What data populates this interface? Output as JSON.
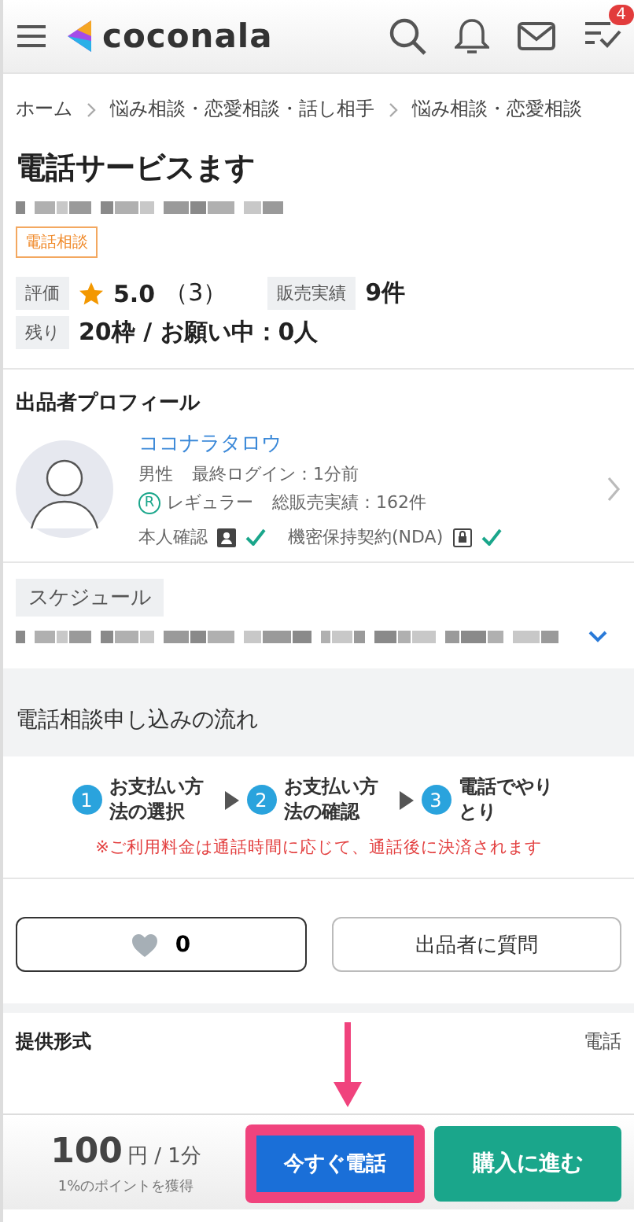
{
  "header": {
    "logo_text": "coconala",
    "badge": "4"
  },
  "breadcrumbs": [
    {
      "label": "ホーム"
    },
    {
      "label": "悩み相談・恋愛相談・話し相手"
    },
    {
      "label": "悩み相談・恋愛相談"
    }
  ],
  "title": "電話サービスます",
  "tag": "電話相談",
  "stats": {
    "rating_label": "評価",
    "rating": "5.0",
    "rating_count": "（3）",
    "sales_label": "販売実績",
    "sales": "9件",
    "remaining_label": "残り",
    "remaining": "20枠 / お願い中：0人"
  },
  "profile": {
    "heading": "出品者プロフィール",
    "name": "ココナラタロウ",
    "gender": "男性",
    "last_login": "最終ログイン：1分前",
    "rank_mark": "R",
    "rank": "レギュラー",
    "total_sales": "総販売実績：162件",
    "verifications": [
      {
        "label": "本人確認",
        "kind": "person",
        "checked": true
      },
      {
        "label": "機密保持契約(NDA)",
        "kind": "lock",
        "checked": true
      }
    ]
  },
  "schedule": {
    "label": "スケジュール"
  },
  "flow": {
    "heading": "電話相談申し込みの流れ",
    "steps": [
      {
        "number": "1",
        "text": "お支払い方法の選択"
      },
      {
        "number": "2",
        "text": "お支払い方法の確認"
      },
      {
        "number": "3",
        "text": "電話でやりとり"
      }
    ],
    "note": "※ご利用料金は通話時間に応じて、通話後に決済されます"
  },
  "actions": {
    "likes": "0",
    "question": "出品者に質問"
  },
  "details": {
    "label": "提供形式",
    "value": "電話"
  },
  "footer": {
    "price": "100",
    "unit": "円 / 1分",
    "points": "1%のポイントを獲得",
    "call": "今すぐ電話",
    "buy": "購入に進む"
  }
}
